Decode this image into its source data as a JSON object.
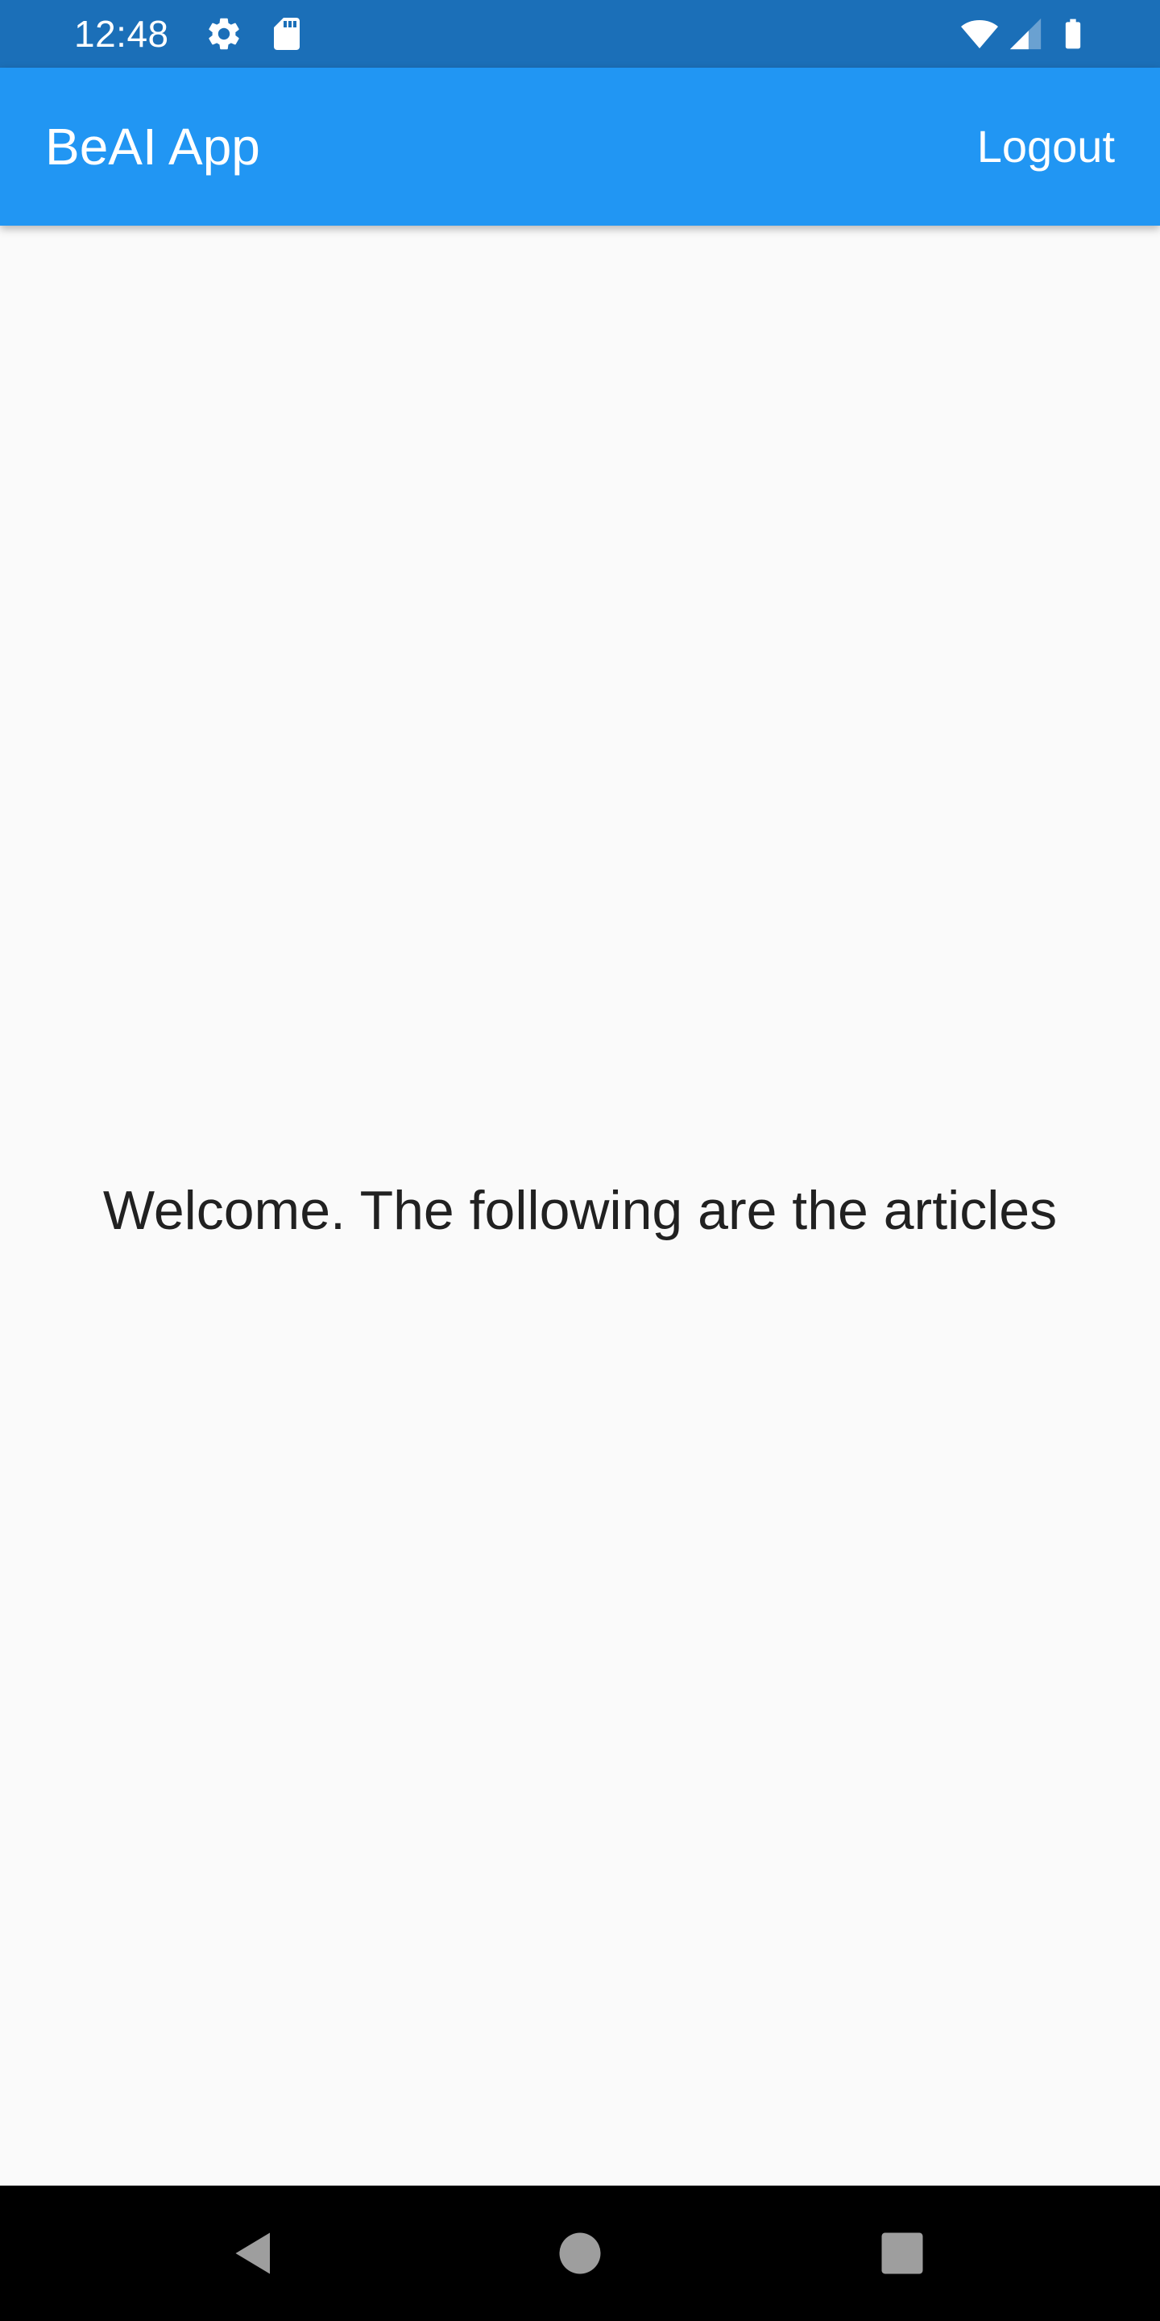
{
  "status_bar": {
    "time": "12:48",
    "icons": [
      "gear-icon",
      "sd-card-icon",
      "wifi-icon",
      "cell-signal-icon",
      "battery-icon"
    ],
    "background": "#1b6fb8"
  },
  "app_bar": {
    "title": "BeAI App",
    "logout_label": "Logout",
    "background": "#2196f3"
  },
  "main": {
    "welcome_text": "Welcome. The following are the articles"
  },
  "nav_bar": {
    "icons": [
      "back-icon",
      "home-icon",
      "recents-icon"
    ],
    "background": "#000000"
  }
}
